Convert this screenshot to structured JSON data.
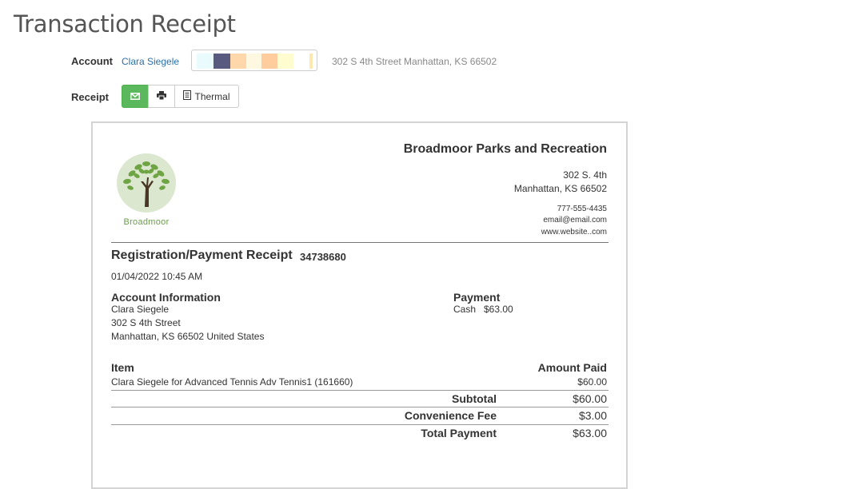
{
  "page": {
    "title": "Transaction Receipt"
  },
  "account": {
    "label": "Account",
    "name": "Clara Siegele",
    "address": "302 S 4th Street Manhattan, KS 66502",
    "color_swatches": [
      "#e9fbfd",
      "#595a80",
      "#ffd7aa",
      "#fff8e0",
      "#ffcc9e",
      "#fffdd0",
      "#ffe7b0"
    ]
  },
  "receipt_controls": {
    "label": "Receipt",
    "thermal_label": "Thermal",
    "email_icon": "envelope-icon",
    "print_icon": "printer-icon",
    "thermal_icon": "document-icon",
    "accent": "#5cb85c"
  },
  "receipt": {
    "logo_text": "Broadmoor",
    "org_name": "Broadmoor Parks and Recreation",
    "address_line1": "302 S. 4th",
    "address_line2": "Manhattan, KS 66502",
    "phone": "777-555-4435",
    "email": "email@email.com",
    "website": "www.website..com",
    "title": "Registration/Payment Receipt",
    "number": "34738680",
    "date": "01/04/2022 10:45 AM",
    "account_info": {
      "heading": "Account Information",
      "name": "Clara Siegele",
      "street": "302 S 4th Street",
      "city_line": "Manhattan, KS 66502 United States"
    },
    "payment": {
      "heading": "Payment",
      "method": "Cash",
      "amount": "$63.00"
    },
    "items_header": {
      "item": "Item",
      "amount": "Amount Paid"
    },
    "items": [
      {
        "description": "Clara Siegele for Advanced Tennis Adv Tennis1 (161660)",
        "amount": "$60.00"
      }
    ],
    "subtotal": {
      "label": "Subtotal",
      "value": "$60.00"
    },
    "fee": {
      "label": "Convenience Fee",
      "value": "$3.00"
    },
    "total": {
      "label": "Total Payment",
      "value": "$63.00"
    }
  }
}
